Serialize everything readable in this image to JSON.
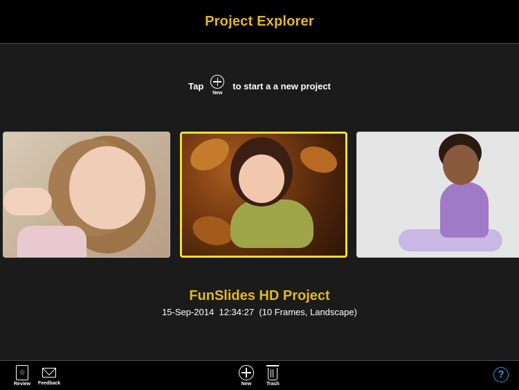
{
  "header": {
    "title": "Project Explorer"
  },
  "hint": {
    "prefix": "Tap",
    "new_caption": "New",
    "suffix": "to start a a new project"
  },
  "projects": [
    {
      "position": "left",
      "image": "girl-lying-portrait"
    },
    {
      "position": "center",
      "image": "girl-in-autumn-leaves",
      "selected": true
    },
    {
      "position": "right",
      "image": "baby-sitting"
    }
  ],
  "selected_project": {
    "name": "FunSlides HD Project",
    "date": "15-Sep-2014",
    "time": "12:34:27",
    "details": "(10 Frames, Landscape)"
  },
  "toolbar": {
    "review_label": "Review",
    "feedback_label": "Feedback",
    "new_label": "New",
    "trash_label": "Trash",
    "help_glyph": "?"
  },
  "colors": {
    "title_gold": "#e2b72a",
    "selection_yellow": "#f2e12c",
    "help_blue": "#2a9ad9",
    "background": "#1b1b1b",
    "bars": "#000000"
  },
  "icons": [
    "review-icon",
    "feedback-icon",
    "new-icon",
    "trash-icon",
    "help-icon"
  ]
}
